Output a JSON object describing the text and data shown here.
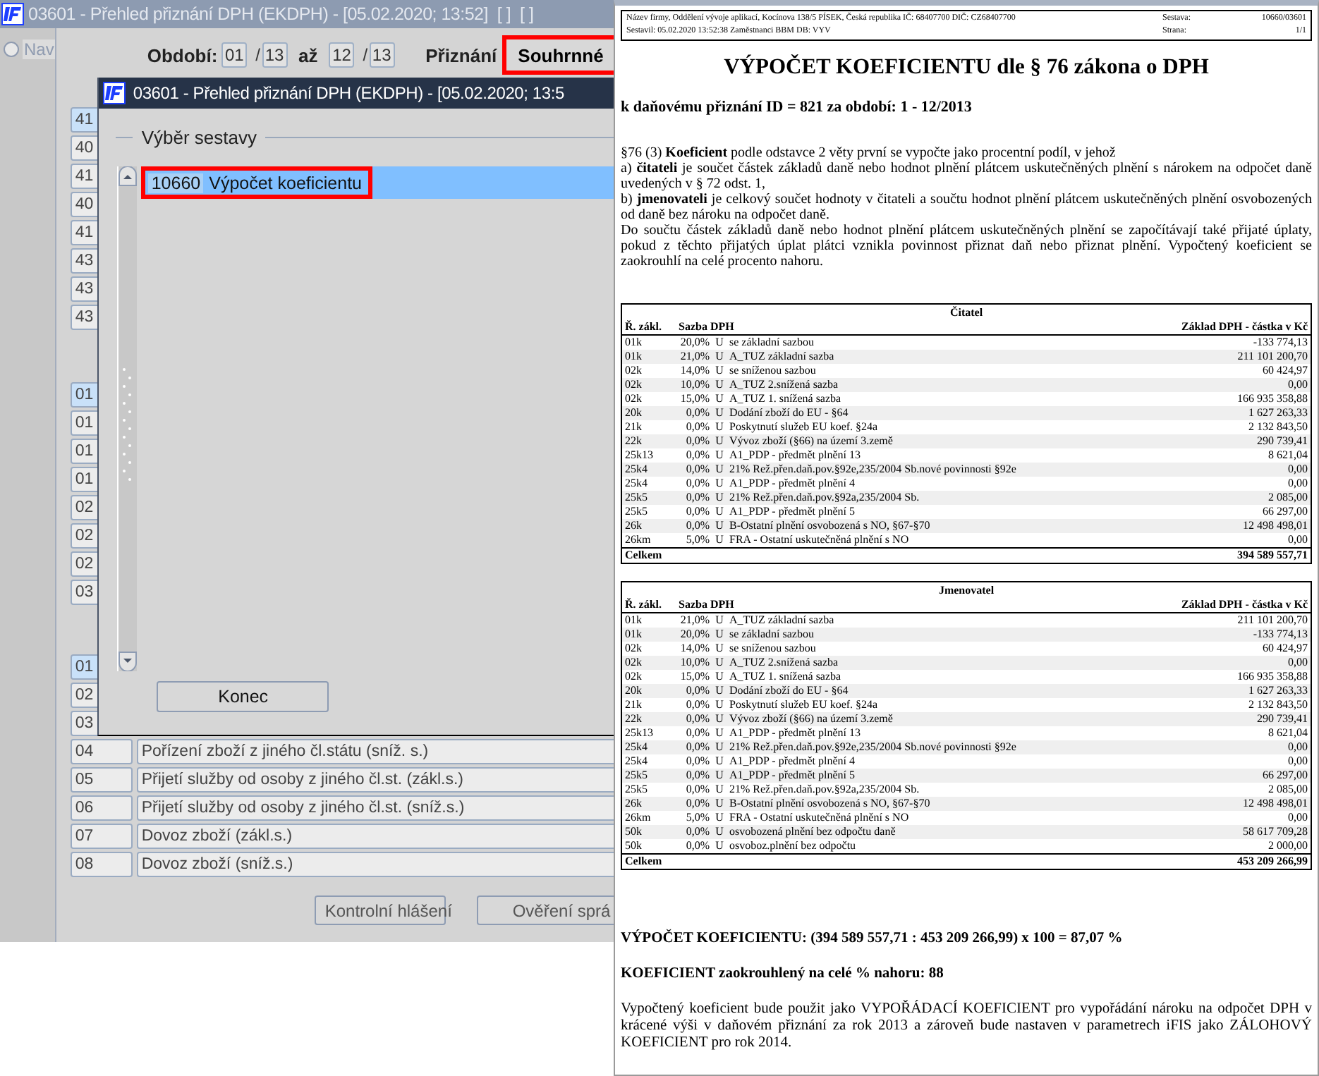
{
  "app": {
    "title": "03601 - Přehled přiznání DPH (EKDPH) - [05.02.2020; 13:52]  [ ]  [ ]",
    "nav": {
      "label": "Nav",
      "checked": false
    },
    "period": {
      "label": "Období:",
      "from_month": "01",
      "from_separator": "/",
      "from_year": "13",
      "to_label": "až",
      "to_month": "12",
      "to_separator": "/",
      "to_year": "13"
    },
    "return_label": "Přiznání",
    "return_type": {
      "value": "Souhrnné",
      "marked": true
    },
    "code_groups": [
      {
        "cells": [
          {
            "code": "41",
            "selected": true
          },
          {
            "code": "40",
            "selected": false
          },
          {
            "code": "41",
            "selected": false
          },
          {
            "code": "40",
            "selected": false
          },
          {
            "code": "41",
            "selected": false
          },
          {
            "code": "43",
            "selected": false
          },
          {
            "code": "43",
            "selected": false
          },
          {
            "code": "43",
            "selected": false
          }
        ]
      },
      {
        "cells": [
          {
            "code": "01",
            "selected": true
          },
          {
            "code": "01",
            "selected": false
          },
          {
            "code": "01",
            "selected": false
          },
          {
            "code": "01",
            "selected": false
          },
          {
            "code": "02",
            "selected": false
          },
          {
            "code": "02",
            "selected": false
          },
          {
            "code": "02",
            "selected": false
          },
          {
            "code": "03",
            "selected": false
          }
        ]
      }
    ],
    "rows": [
      {
        "code": "01",
        "selected": true
      },
      {
        "code": "02",
        "selected": false
      },
      {
        "code": "03",
        "selected": false
      },
      {
        "code": "04",
        "label": "Pořízení zboží z jiného čl.státu (sníž. s.)",
        "selected": false
      },
      {
        "code": "05",
        "label": "Přijetí služby od osoby z jiného čl.st. (zákl.s.)",
        "selected": false
      },
      {
        "code": "06",
        "label": "Přijetí služby od osoby z jiného čl.st. (sníž.s.)",
        "selected": false
      },
      {
        "code": "07",
        "label": "Dovoz zboží (zákl.s.)",
        "selected": false
      },
      {
        "code": "08",
        "label": "Dovoz zboží (sníž.s.)",
        "selected": false
      }
    ],
    "buttons": [
      "Kontrolní hlášení",
      "Ověření sprá"
    ]
  },
  "dialog": {
    "title": "03601 - Přehled přiznání DPH (EKDPH) - [05.02.2020; 13:5",
    "group_label": "Výběr sestavy",
    "reports": [
      {
        "code": "10660",
        "name": "Výpočet koeficientu",
        "selected": true,
        "marked": true
      }
    ],
    "close_button": "Konec"
  },
  "report": {
    "header": [
      [
        "Název firmy, Oddělení vývoje aplikací, Kocínova 138/5 PÍSEK, Česká republika  IČ: 68407700  DIČ: CZ68407700",
        "Sestava:",
        "10660/03601"
      ],
      [
        "Sestavil: 05.02.2020 13:52:38 Zaměstnanci BBM  DB: VYV",
        "Strana:",
        "1/1"
      ]
    ],
    "title": "VÝPOČET KOEFICIENTU dle § 76 zákona o DPH",
    "subtitle": "k daňovému přiznání ID = 821 za období: 1 - 12/2013",
    "paragraphs": [
      "§76 (3) **Koeficient** podle odstavce 2 věty první se vypočte jako procentní podíl, v jehož",
      "a) **čitateli** je součet částek základů daně nebo hodnot plnění plátcem uskutečněných plnění s nárokem na odpočet daně uvedených v § 72 odst. 1,",
      "b) **jmenovateli** je celkový součet hodnoty v čitateli a součtu hodnot plnění plátcem uskutečněných plnění osvobozených od daně bez nároku na odpočet daně.",
      "Do součtu částek základů daně nebo hodnot plnění plátcem uskutečněných plnění se započítávají také přijaté úplaty, pokud z těchto přijatých úplat plátci vznikla povinnost přiznat daň nebo přiznat plnění. Vypočtený koeficient se zaokrouhlí na celé procento nahoru."
    ],
    "tables": [
      {
        "title": "Čitatel",
        "columns": [
          "Ř. zákl.",
          "Sazba DPH",
          "Základ DPH - částka v Kč"
        ],
        "rows": [
          {
            "code": "01k",
            "rate": "20,0%",
            "flag": "U",
            "text": "se základní sazbou",
            "amount": "-133 774,13"
          },
          {
            "code": "01k",
            "rate": "21,0%",
            "flag": "U",
            "text": "A_TUZ základní sazba",
            "amount": "211 101 200,70"
          },
          {
            "code": "02k",
            "rate": "14,0%",
            "flag": "U",
            "text": "se sníženou sazbou",
            "amount": "60 424,97"
          },
          {
            "code": "02k",
            "rate": "10,0%",
            "flag": "U",
            "text": "A_TUZ 2.snížená sazba",
            "amount": "0,00"
          },
          {
            "code": "02k",
            "rate": "15,0%",
            "flag": "U",
            "text": "A_TUZ 1. snížená sazba",
            "amount": "166 935 358,88"
          },
          {
            "code": "20k",
            "rate": "0,0%",
            "flag": "U",
            "text": "Dodání zboží do EU - §64",
            "amount": "1 627 263,33"
          },
          {
            "code": "21k",
            "rate": "0,0%",
            "flag": "U",
            "text": "Poskytnutí služeb EU koef. §24a",
            "amount": "2 132 843,50"
          },
          {
            "code": "22k",
            "rate": "0,0%",
            "flag": "U",
            "text": "Vývoz zboží (§66) na území 3.země",
            "amount": "290 739,41"
          },
          {
            "code": "25k13",
            "rate": "0,0%",
            "flag": "U",
            "text": "A1_PDP - předmět plnění 13",
            "amount": "8 621,04"
          },
          {
            "code": "25k4",
            "rate": "0,0%",
            "flag": "U",
            "text": "21% Rež.přen.daň.pov.§92e,235/2004 Sb.nové povinnosti §92e",
            "amount": "0,00"
          },
          {
            "code": "25k4",
            "rate": "0,0%",
            "flag": "U",
            "text": "A1_PDP - předmět plnění 4",
            "amount": "0,00"
          },
          {
            "code": "25k5",
            "rate": "0,0%",
            "flag": "U",
            "text": "21% Rež.přen.daň.pov.§92a,235/2004 Sb.",
            "amount": "2 085,00"
          },
          {
            "code": "25k5",
            "rate": "0,0%",
            "flag": "U",
            "text": "A1_PDP - předmět plnění 5",
            "amount": "66 297,00"
          },
          {
            "code": "26k",
            "rate": "0,0%",
            "flag": "U",
            "text": "B-Ostatní plnění osvobozená s NO, §67-§70",
            "amount": "12 498 498,01"
          },
          {
            "code": "26km",
            "rate": "5,0%",
            "flag": "U",
            "text": "FRA - Ostatní uskutečněná plnění s NO",
            "amount": "0,00"
          }
        ],
        "total": {
          "label": "Celkem",
          "amount": "394 589 557,71"
        }
      },
      {
        "title": "Jmenovatel",
        "columns": [
          "Ř. zákl.",
          "Sazba DPH",
          "Základ DPH - částka v Kč"
        ],
        "rows": [
          {
            "code": "01k",
            "rate": "21,0%",
            "flag": "U",
            "text": "A_TUZ základní sazba",
            "amount": "211 101 200,70"
          },
          {
            "code": "01k",
            "rate": "20,0%",
            "flag": "U",
            "text": "se základní sazbou",
            "amount": "-133 774,13"
          },
          {
            "code": "02k",
            "rate": "14,0%",
            "flag": "U",
            "text": "se sníženou sazbou",
            "amount": "60 424,97"
          },
          {
            "code": "02k",
            "rate": "10,0%",
            "flag": "U",
            "text": "A_TUZ 2.snížená sazba",
            "amount": "0,00"
          },
          {
            "code": "02k",
            "rate": "15,0%",
            "flag": "U",
            "text": "A_TUZ 1. snížená sazba",
            "amount": "166 935 358,88"
          },
          {
            "code": "20k",
            "rate": "0,0%",
            "flag": "U",
            "text": "Dodání zboží do EU - §64",
            "amount": "1 627 263,33"
          },
          {
            "code": "21k",
            "rate": "0,0%",
            "flag": "U",
            "text": "Poskytnutí služeb EU koef. §24a",
            "amount": "2 132 843,50"
          },
          {
            "code": "22k",
            "rate": "0,0%",
            "flag": "U",
            "text": "Vývoz zboží (§66) na území 3.země",
            "amount": "290 739,41"
          },
          {
            "code": "25k13",
            "rate": "0,0%",
            "flag": "U",
            "text": "A1_PDP - předmět plnění 13",
            "amount": "8 621,04"
          },
          {
            "code": "25k4",
            "rate": "0,0%",
            "flag": "U",
            "text": "21% Rež.přen.daň.pov.§92e,235/2004 Sb.nové povinnosti §92e",
            "amount": "0,00"
          },
          {
            "code": "25k4",
            "rate": "0,0%",
            "flag": "U",
            "text": "A1_PDP - předmět plnění 4",
            "amount": "0,00"
          },
          {
            "code": "25k5",
            "rate": "0,0%",
            "flag": "U",
            "text": "A1_PDP - předmět plnění 5",
            "amount": "66 297,00"
          },
          {
            "code": "25k5",
            "rate": "0,0%",
            "flag": "U",
            "text": "21% Rež.přen.daň.pov.§92a,235/2004 Sb.",
            "amount": "2 085,00"
          },
          {
            "code": "26k",
            "rate": "0,0%",
            "flag": "U",
            "text": "B-Ostatní plnění osvobozená s NO, §67-§70",
            "amount": "12 498 498,01"
          },
          {
            "code": "26km",
            "rate": "5,0%",
            "flag": "U",
            "text": "FRA - Ostatní uskutečněná plnění s NO",
            "amount": "0,00"
          },
          {
            "code": "50k",
            "rate": "0,0%",
            "flag": "U",
            "text": "osvobozená plnění bez odpočtu daně",
            "amount": "58 617 709,28"
          },
          {
            "code": "50k",
            "rate": "0,0%",
            "flag": "U",
            "text": "osvoboz.plnění bez odpočtu",
            "amount": "2 000,00"
          }
        ],
        "total": {
          "label": "Celkem",
          "amount": "453 209 266,99"
        }
      }
    ],
    "result": "VÝPOČET KOEFICIENTU: (394 589 557,71 : 453 209 266,99) x 100 =  87,07 %",
    "rounded": "KOEFICIENT zaokrouhlený na celé % nahoru:  88",
    "note": "Vypočtený koeficient bude použit jako VYPOŘÁDACÍ KOEFICIENT pro vypořádání nároku na odpočet DPH v krácené výši v daňovém přiznání za rok 2013 a zároveň bude nastaven v parametrech iFIS jako ZÁLOHOVÝ KOEFICIENT pro rok 2014."
  }
}
